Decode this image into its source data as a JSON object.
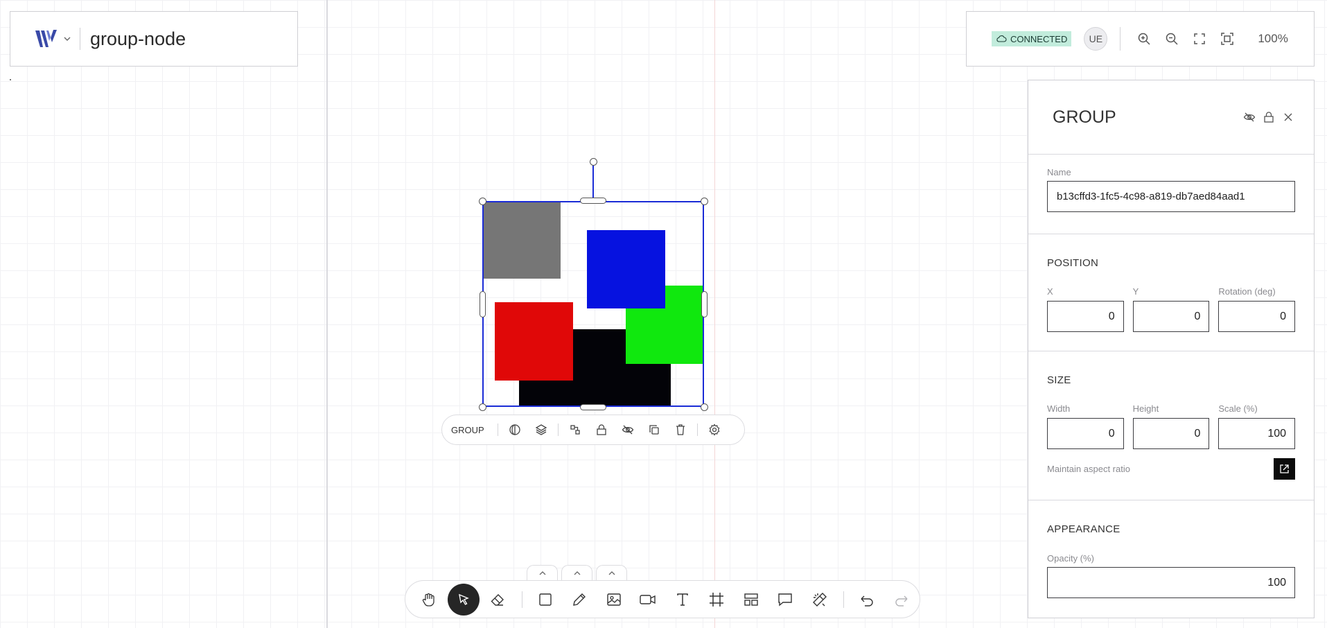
{
  "app": {
    "project_title": "group-node",
    "status": "CONNECTED",
    "user_initials": "UE",
    "zoom_level": "100%"
  },
  "panel": {
    "title": "GROUP",
    "name_label": "Name",
    "name_value": "b13cffd3-1fc5-4c98-a819-db7aed84aad1",
    "position": {
      "title": "POSITION",
      "x_label": "X",
      "x_value": "0",
      "y_label": "Y",
      "y_value": "0",
      "rotation_label": "Rotation (deg)",
      "rotation_value": "0"
    },
    "size": {
      "title": "SIZE",
      "width_label": "Width",
      "width_value": "0",
      "height_label": "Height",
      "height_value": "0",
      "scale_label": "Scale (%)",
      "scale_value": "100",
      "aspect_label": "Maintain aspect ratio"
    },
    "appearance": {
      "title": "APPEARANCE",
      "opacity_label": "Opacity (%)",
      "opacity_value": "100"
    }
  },
  "context_toolbar": {
    "label": "GROUP",
    "icons": [
      "mask-icon",
      "layers-icon",
      "ungroup-icon",
      "lock-icon",
      "hide-icon",
      "duplicate-icon",
      "delete-icon",
      "settings-icon"
    ]
  },
  "bottom_toolbar": {
    "tools": [
      "hand-tool-icon",
      "select-tool-icon",
      "eraser-tool-icon",
      "rectangle-tool-icon",
      "pen-tool-icon",
      "image-tool-icon",
      "video-tool-icon",
      "text-tool-icon",
      "frame-tool-icon",
      "layout-tool-icon",
      "comment-tool-icon",
      "magic-tool-icon",
      "undo-icon",
      "redo-icon"
    ],
    "active_tool": "select-tool-icon"
  },
  "colors": {
    "accent_selection": "#1a2bd6",
    "status_bg": "#c2ecdc",
    "shape_gray": "#767676",
    "shape_blue": "#0612e0",
    "shape_red": "#e00808",
    "shape_green": "#10e80e",
    "shape_black": "#030308"
  }
}
